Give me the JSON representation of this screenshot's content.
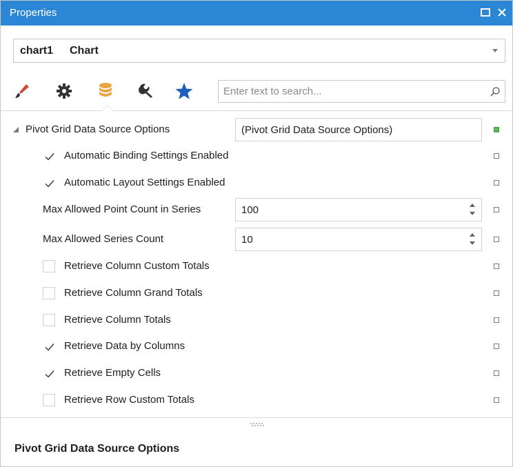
{
  "window": {
    "title": "Properties"
  },
  "object_selector": {
    "name": "chart1",
    "type": "Chart"
  },
  "toolbar": {
    "tabs": [
      {
        "icon": "paintbrush-icon",
        "tooltip": ""
      },
      {
        "icon": "gear-icon",
        "tooltip": ""
      },
      {
        "icon": "database-icon",
        "tooltip": ""
      },
      {
        "icon": "wrench-icon",
        "tooltip": ""
      },
      {
        "icon": "star-icon",
        "tooltip": ""
      }
    ],
    "active_tab_index": 2
  },
  "search": {
    "placeholder": "Enter text to search...",
    "value": ""
  },
  "properties": {
    "group": {
      "label": "Pivot Grid Data Source Options",
      "value": "(Pivot Grid Data Source Options)",
      "expanded": true
    },
    "rows": [
      {
        "label": "Automatic Binding Settings Enabled",
        "kind": "checkbox",
        "checked": true
      },
      {
        "label": "Automatic Layout Settings Enabled",
        "kind": "checkbox",
        "checked": true
      },
      {
        "label": "Max Allowed Point Count in Series",
        "kind": "spin",
        "value": "100"
      },
      {
        "label": "Max Allowed Series Count",
        "kind": "spin",
        "value": "10"
      },
      {
        "label": "Retrieve Column Custom Totals",
        "kind": "checkbox",
        "checked": false
      },
      {
        "label": "Retrieve Column Grand Totals",
        "kind": "checkbox",
        "checked": false
      },
      {
        "label": "Retrieve Column Totals",
        "kind": "checkbox",
        "checked": false
      },
      {
        "label": "Retrieve Data by Columns",
        "kind": "checkbox",
        "checked": true
      },
      {
        "label": "Retrieve Empty Cells",
        "kind": "checkbox",
        "checked": true
      },
      {
        "label": "Retrieve Row Custom Totals",
        "kind": "checkbox",
        "checked": false
      }
    ]
  },
  "description": {
    "title": "Pivot Grid Data Source Options"
  },
  "colors": {
    "titlebar": "#2b87d6",
    "accent_star": "#1e5fbf",
    "database": "#e8a545",
    "modified_marker": "#62b562"
  }
}
